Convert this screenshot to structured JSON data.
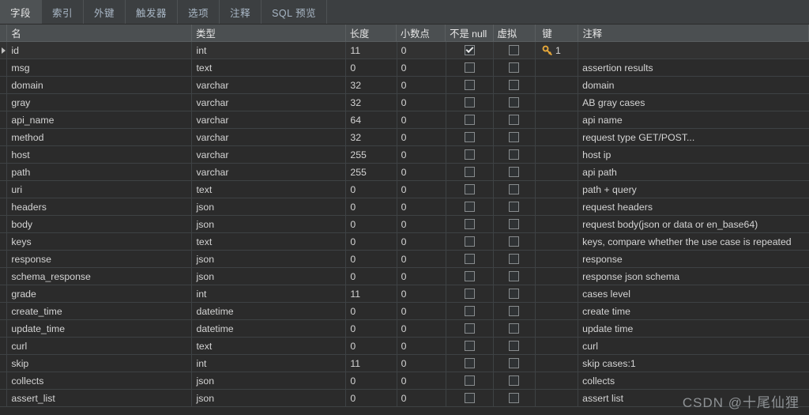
{
  "tabs": [
    {
      "label": "字段",
      "active": true
    },
    {
      "label": "索引",
      "active": false
    },
    {
      "label": "外键",
      "active": false
    },
    {
      "label": "触发器",
      "active": false
    },
    {
      "label": "选项",
      "active": false
    },
    {
      "label": "注释",
      "active": false
    },
    {
      "label": "SQL 预览",
      "active": false
    }
  ],
  "grid": {
    "columns": [
      {
        "key": "name",
        "label": "名"
      },
      {
        "key": "type",
        "label": "类型"
      },
      {
        "key": "length",
        "label": "长度"
      },
      {
        "key": "decimals",
        "label": "小数点"
      },
      {
        "key": "notnull",
        "label": "不是 null"
      },
      {
        "key": "virtual",
        "label": "虚拟"
      },
      {
        "key": "key",
        "label": "键"
      },
      {
        "key": "comment",
        "label": "注释"
      }
    ],
    "rows": [
      {
        "name": "id",
        "type": "int",
        "length": "11",
        "decimals": "0",
        "notnull": true,
        "virtual": false,
        "key": "1",
        "comment": "",
        "selected": true
      },
      {
        "name": "msg",
        "type": "text",
        "length": "0",
        "decimals": "0",
        "notnull": false,
        "virtual": false,
        "key": "",
        "comment": "assertion results",
        "selected": false
      },
      {
        "name": "domain",
        "type": "varchar",
        "length": "32",
        "decimals": "0",
        "notnull": false,
        "virtual": false,
        "key": "",
        "comment": "domain",
        "selected": false
      },
      {
        "name": "gray",
        "type": "varchar",
        "length": "32",
        "decimals": "0",
        "notnull": false,
        "virtual": false,
        "key": "",
        "comment": "AB gray cases",
        "selected": false
      },
      {
        "name": "api_name",
        "type": "varchar",
        "length": "64",
        "decimals": "0",
        "notnull": false,
        "virtual": false,
        "key": "",
        "comment": "api name",
        "selected": false
      },
      {
        "name": "method",
        "type": "varchar",
        "length": "32",
        "decimals": "0",
        "notnull": false,
        "virtual": false,
        "key": "",
        "comment": "request type GET/POST...",
        "selected": false
      },
      {
        "name": "host",
        "type": "varchar",
        "length": "255",
        "decimals": "0",
        "notnull": false,
        "virtual": false,
        "key": "",
        "comment": "host ip",
        "selected": false
      },
      {
        "name": "path",
        "type": "varchar",
        "length": "255",
        "decimals": "0",
        "notnull": false,
        "virtual": false,
        "key": "",
        "comment": "api path",
        "selected": false
      },
      {
        "name": "uri",
        "type": "text",
        "length": "0",
        "decimals": "0",
        "notnull": false,
        "virtual": false,
        "key": "",
        "comment": "path + query",
        "selected": false
      },
      {
        "name": "headers",
        "type": "json",
        "length": "0",
        "decimals": "0",
        "notnull": false,
        "virtual": false,
        "key": "",
        "comment": "request headers",
        "selected": false
      },
      {
        "name": "body",
        "type": "json",
        "length": "0",
        "decimals": "0",
        "notnull": false,
        "virtual": false,
        "key": "",
        "comment": "request  body(json or data or en_base64)",
        "selected": false
      },
      {
        "name": "keys",
        "type": "text",
        "length": "0",
        "decimals": "0",
        "notnull": false,
        "virtual": false,
        "key": "",
        "comment": "keys, compare whether the use case is repeated",
        "selected": false
      },
      {
        "name": "response",
        "type": "json",
        "length": "0",
        "decimals": "0",
        "notnull": false,
        "virtual": false,
        "key": "",
        "comment": "response",
        "selected": false
      },
      {
        "name": "schema_response",
        "type": "json",
        "length": "0",
        "decimals": "0",
        "notnull": false,
        "virtual": false,
        "key": "",
        "comment": "response json schema",
        "selected": false
      },
      {
        "name": "grade",
        "type": "int",
        "length": "11",
        "decimals": "0",
        "notnull": false,
        "virtual": false,
        "key": "",
        "comment": "cases level",
        "selected": false
      },
      {
        "name": "create_time",
        "type": "datetime",
        "length": "0",
        "decimals": "0",
        "notnull": false,
        "virtual": false,
        "key": "",
        "comment": "create time",
        "selected": false
      },
      {
        "name": "update_time",
        "type": "datetime",
        "length": "0",
        "decimals": "0",
        "notnull": false,
        "virtual": false,
        "key": "",
        "comment": "update time",
        "selected": false
      },
      {
        "name": "curl",
        "type": "text",
        "length": "0",
        "decimals": "0",
        "notnull": false,
        "virtual": false,
        "key": "",
        "comment": "curl",
        "selected": false
      },
      {
        "name": "skip",
        "type": "int",
        "length": "11",
        "decimals": "0",
        "notnull": false,
        "virtual": false,
        "key": "",
        "comment": "skip cases:1",
        "selected": false
      },
      {
        "name": "collects",
        "type": "json",
        "length": "0",
        "decimals": "0",
        "notnull": false,
        "virtual": false,
        "key": "",
        "comment": "collects",
        "selected": false
      },
      {
        "name": "assert_list",
        "type": "json",
        "length": "0",
        "decimals": "0",
        "notnull": false,
        "virtual": false,
        "key": "",
        "comment": "assert list",
        "selected": false
      }
    ]
  },
  "watermark": {
    "text": "CSDN @十尾仙狸"
  },
  "colors": {
    "key_icon": "#e8a93a",
    "tab_active_bg": "#4e5254",
    "grid_bg": "#2b2b2b",
    "header_bg": "#4b4f51"
  }
}
